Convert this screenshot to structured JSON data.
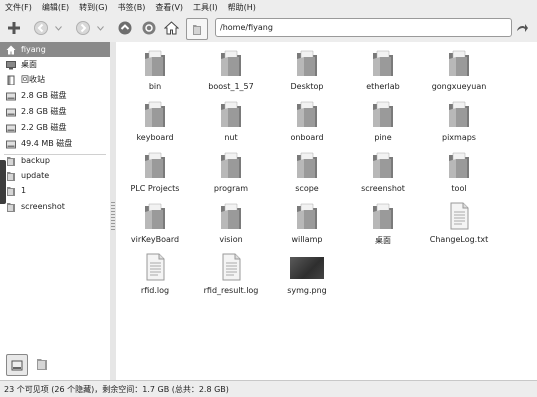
{
  "menu": [
    "文件(F)",
    "编辑(E)",
    "转到(G)",
    "书签(B)",
    "查看(V)",
    "工具(I)",
    "帮助(H)"
  ],
  "location": {
    "path": "/home/fiyang"
  },
  "sidebar": {
    "places": [
      {
        "label": "fiyang",
        "icon": "home-icon",
        "selected": true
      },
      {
        "label": "桌面",
        "icon": "desktop-icon"
      },
      {
        "label": "回收站",
        "icon": "trash-icon"
      },
      {
        "label": "2.8 GB 磁盘",
        "icon": "drive-icon"
      },
      {
        "label": "2.8 GB 磁盘",
        "icon": "drive-icon"
      },
      {
        "label": "2.2 GB 磁盘",
        "icon": "drive-icon"
      },
      {
        "label": "49.4 MB 磁盘",
        "icon": "drive-icon"
      }
    ],
    "bookmarks": [
      {
        "label": "backup",
        "icon": "folder-icon"
      },
      {
        "label": "update",
        "icon": "folder-icon"
      },
      {
        "label": "1",
        "icon": "folder-icon"
      },
      {
        "label": "screenshot",
        "icon": "folder-icon"
      }
    ]
  },
  "files": [
    {
      "name": "bin",
      "type": "folder"
    },
    {
      "name": "boost_1_57",
      "type": "folder"
    },
    {
      "name": "Desktop",
      "type": "folder"
    },
    {
      "name": "etherlab",
      "type": "folder"
    },
    {
      "name": "gongxueyuan",
      "type": "folder"
    },
    {
      "name": "keyboard",
      "type": "folder"
    },
    {
      "name": "nut",
      "type": "folder"
    },
    {
      "name": "onboard",
      "type": "folder"
    },
    {
      "name": "pine",
      "type": "folder"
    },
    {
      "name": "pixmaps",
      "type": "folder"
    },
    {
      "name": "PLC Projects",
      "type": "folder"
    },
    {
      "name": "program",
      "type": "folder"
    },
    {
      "name": "scope",
      "type": "folder"
    },
    {
      "name": "screenshot",
      "type": "folder"
    },
    {
      "name": "tool",
      "type": "folder"
    },
    {
      "name": "virKeyBoard",
      "type": "folder"
    },
    {
      "name": "vision",
      "type": "folder"
    },
    {
      "name": "willamp",
      "type": "folder"
    },
    {
      "name": "桌面",
      "type": "folder"
    },
    {
      "name": "ChangeLog.txt",
      "type": "text"
    },
    {
      "name": "rfid.log",
      "type": "text"
    },
    {
      "name": "rfid_result.log",
      "type": "text"
    },
    {
      "name": "symg.png",
      "type": "image"
    }
  ],
  "status": "23 个可见项 (26 个隐藏)，剩余空间：1.7 GB (总共：2.8 GB)",
  "colors": {
    "folder": "#8f8f8f",
    "selection": "#8a8a8a",
    "window_bg": "#ededed"
  }
}
